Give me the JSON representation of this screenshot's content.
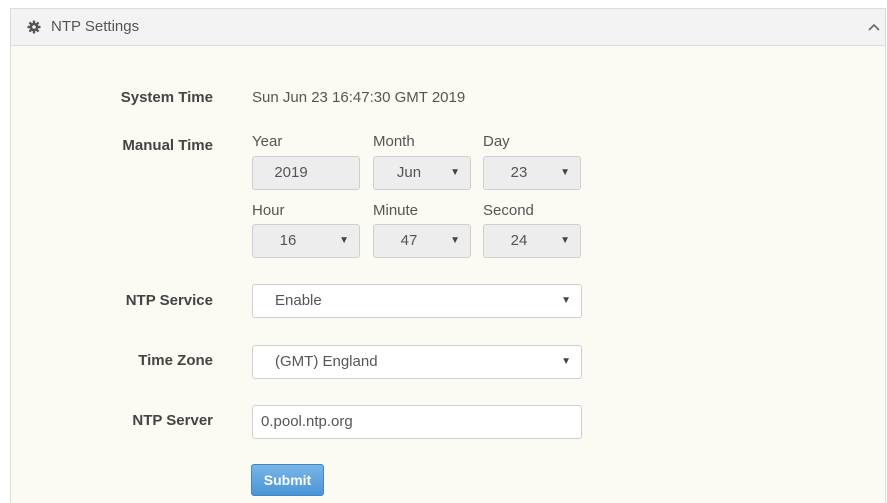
{
  "panel": {
    "title": "NTP Settings",
    "icon": "gear-icon",
    "collapse_icon": "chevron-up-icon"
  },
  "system_time": {
    "label": "System Time",
    "value": "Sun Jun 23 16:47:30 GMT 2019"
  },
  "manual_time": {
    "label": "Manual Time",
    "year": {
      "label": "Year",
      "value": "2019"
    },
    "month": {
      "label": "Month",
      "value": "Jun"
    },
    "day": {
      "label": "Day",
      "value": "23"
    },
    "hour": {
      "label": "Hour",
      "value": "16"
    },
    "minute": {
      "label": "Minute",
      "value": "47"
    },
    "second": {
      "label": "Second",
      "value": "24"
    }
  },
  "ntp_service": {
    "label": "NTP Service",
    "value": "Enable"
  },
  "time_zone": {
    "label": "Time Zone",
    "value": "(GMT) England"
  },
  "ntp_server": {
    "label": "NTP Server",
    "value": "0.pool.ntp.org"
  },
  "submit_label": "Submit",
  "caret_glyph": "▼"
}
